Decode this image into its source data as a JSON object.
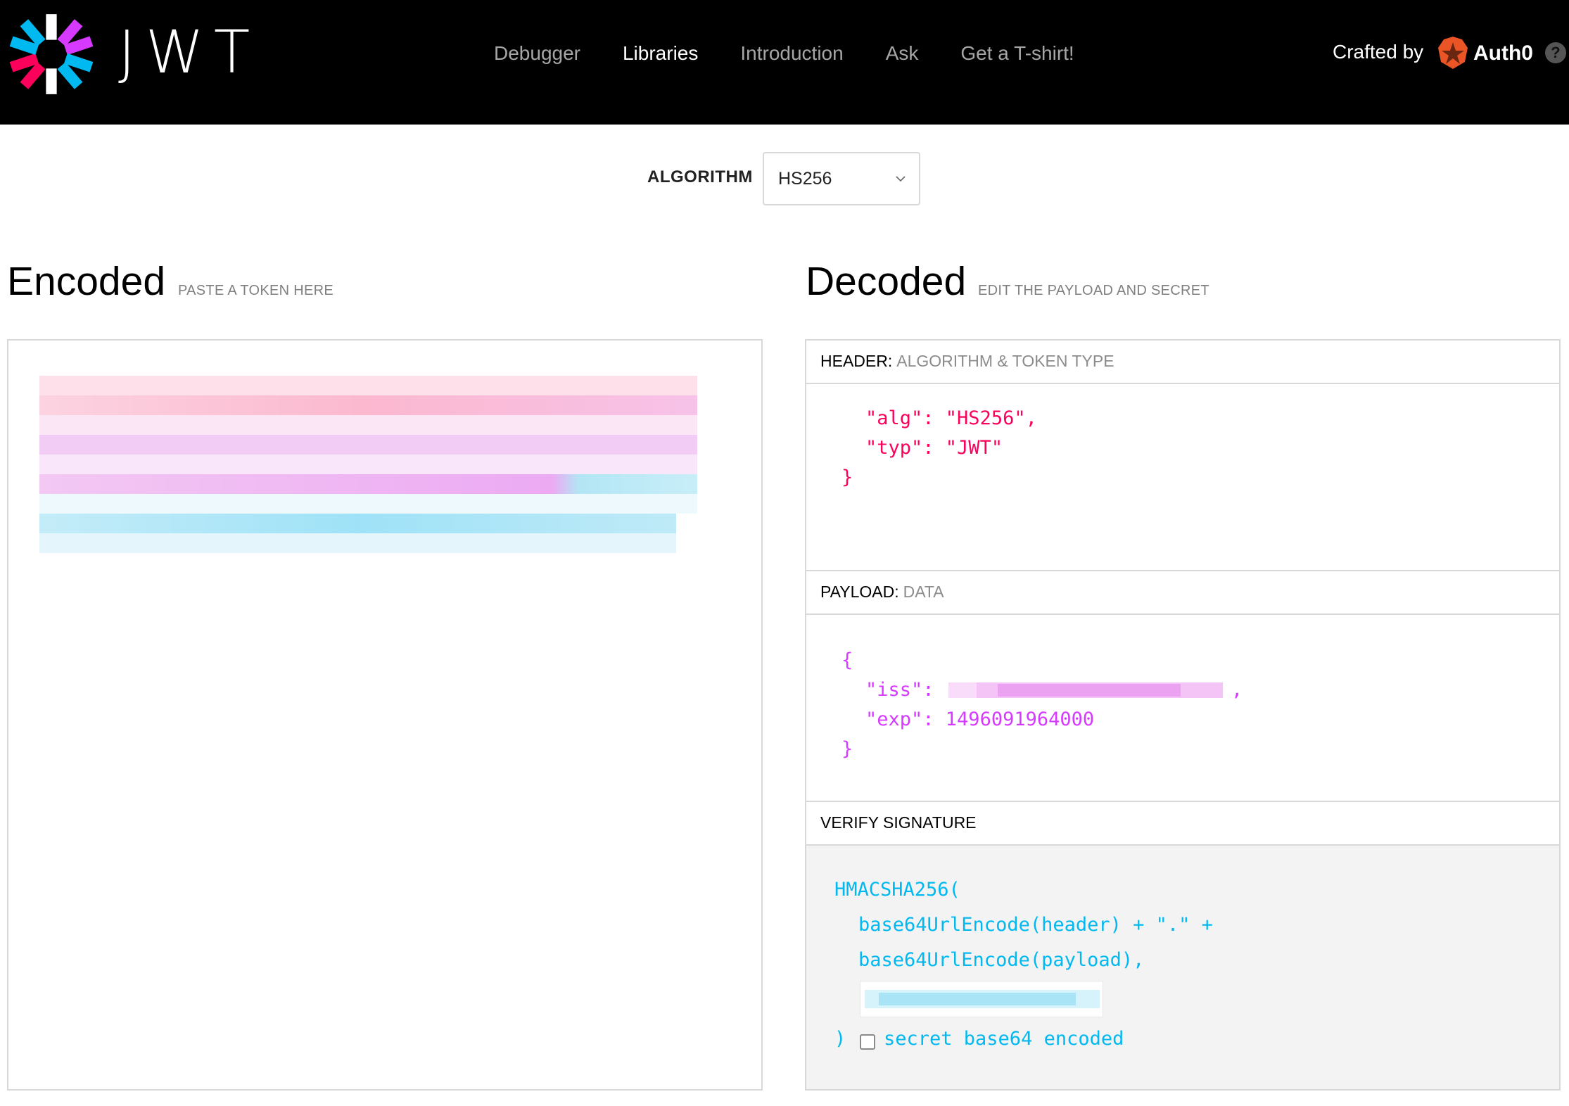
{
  "brand": {
    "name": "JWT"
  },
  "nav": {
    "links": [
      {
        "label": "Debugger",
        "active": false
      },
      {
        "label": "Libraries",
        "active": true
      },
      {
        "label": "Introduction",
        "active": false
      },
      {
        "label": "Ask",
        "active": false
      },
      {
        "label": "Get a T-shirt!",
        "active": false
      }
    ],
    "crafted_by": "Crafted by",
    "partner": "Auth0",
    "help": "?"
  },
  "algorithm": {
    "label": "ALGORITHM",
    "selected": "HS256"
  },
  "encoded": {
    "title": "Encoded",
    "subtitle": "PASTE A TOKEN HERE"
  },
  "decoded": {
    "title": "Decoded",
    "subtitle": "EDIT THE PAYLOAD AND SECRET",
    "header": {
      "label": "HEADER:",
      "sub": "ALGORITHM & TOKEN TYPE",
      "alg_key": "\"alg\"",
      "alg_value": "\"HS256\"",
      "typ_key": "\"typ\"",
      "typ_value": "\"JWT\""
    },
    "payload": {
      "label": "PAYLOAD:",
      "sub": "DATA",
      "iss_key": "\"iss\"",
      "exp_key": "\"exp\"",
      "exp_value": "1496091964000"
    },
    "verify": {
      "label": "VERIFY SIGNATURE",
      "fn": "HMACSHA256(",
      "line1": "base64UrlEncode(header) + \".\" +",
      "line2": "base64UrlEncode(payload),",
      "close": ")",
      "checkbox_label": "secret base64 encoded"
    }
  },
  "colors": {
    "header_json": "#fb015b",
    "payload_json": "#d63aff",
    "signature": "#00b9f1",
    "nav_bg": "#000000"
  }
}
